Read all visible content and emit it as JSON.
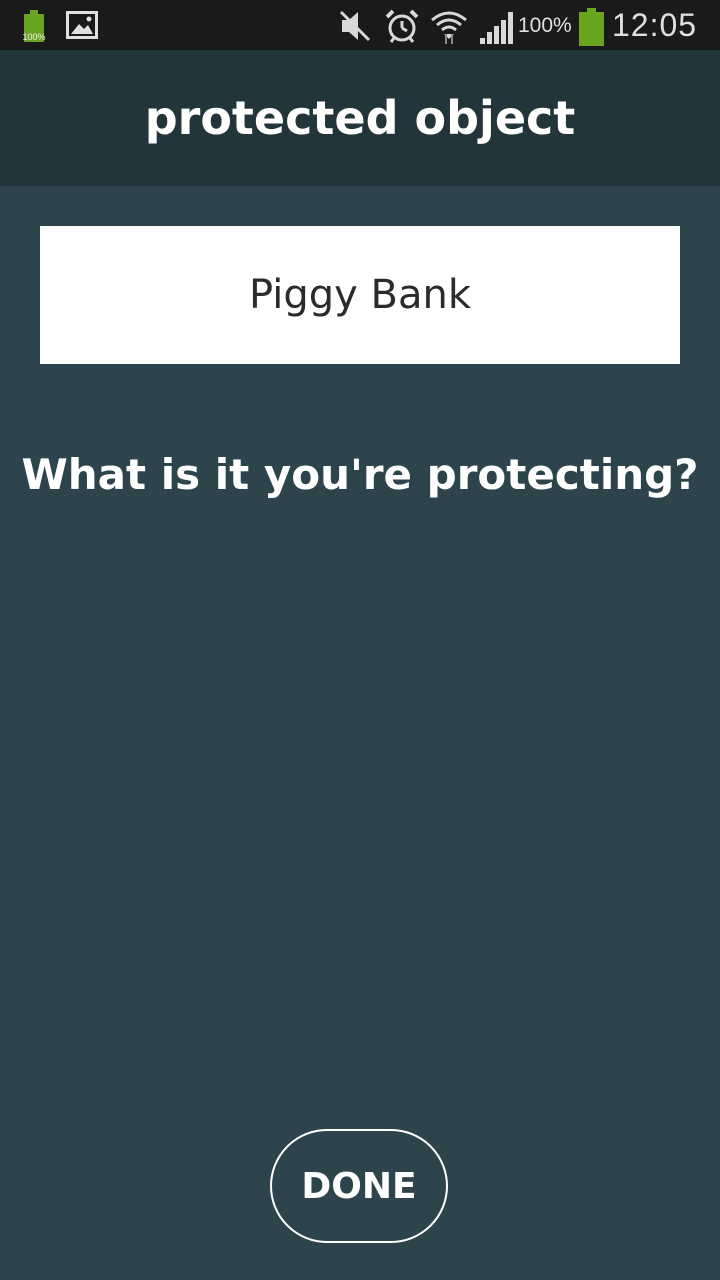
{
  "status_bar": {
    "left_battery_label": "100%",
    "icons": [
      "battery-icon",
      "gallery-icon",
      "mute-icon",
      "alarm-icon",
      "wifi-icon",
      "signal-icon",
      "battery-icon"
    ],
    "battery_percent": "100%",
    "time": "12:05",
    "battery_color": "#6aa520"
  },
  "header": {
    "title": "protected object"
  },
  "form": {
    "object_value": "Piggy Bank",
    "prompt": "What is it you're protecting?"
  },
  "actions": {
    "done_label": "DONE"
  },
  "colors": {
    "background": "#2d444c",
    "header_background": "#22353b",
    "status_bar": "#1a1a1a",
    "text": "#ffffff"
  }
}
